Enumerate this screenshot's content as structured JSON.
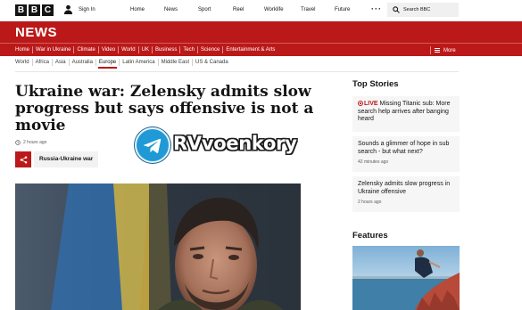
{
  "header": {
    "logo_letters": [
      "B",
      "B",
      "C"
    ],
    "signin_label": "Sign In",
    "nav": [
      "Home",
      "News",
      "Sport",
      "Reel",
      "Worklife",
      "Travel",
      "Future"
    ],
    "more_icon": "ellipsis-icon",
    "search_placeholder": "Search BBC"
  },
  "news_bar": {
    "logo": "NEWS",
    "sections": [
      "Home",
      "War in Ukraine",
      "Climate",
      "Video",
      "World",
      "UK",
      "Business",
      "Tech",
      "Science",
      "Entertainment & Arts"
    ],
    "more_label": "More"
  },
  "sub_nav": {
    "items": [
      "World",
      "Africa",
      "Asia",
      "Australia",
      "Europe",
      "Latin America",
      "Middle East",
      "US & Canada"
    ],
    "active": "Europe"
  },
  "article": {
    "headline": "Ukraine war: Zelensky admits slow progress but says offensive is not a movie",
    "timestamp": "2 hours ago",
    "topic_tag": "Russia-Ukraine war"
  },
  "watermark": {
    "text": "RVvoenkory",
    "icon": "telegram-icon"
  },
  "sidebar": {
    "top_stories_title": "Top Stories",
    "stories": [
      {
        "live": "LIVE",
        "text": "Missing Titanic sub: More search help arrives after banging heard",
        "time": ""
      },
      {
        "live": "",
        "text": "Sounds a glimmer of hope in sub search - but what next?",
        "time": "42 minutes ago"
      },
      {
        "live": "",
        "text": "Zelensky admits slow progress in Ukraine offensive",
        "time": "2 hours ago"
      }
    ],
    "features_title": "Features"
  },
  "colors": {
    "bbc_red": "#bb1919",
    "card_bg": "#f6f6f6",
    "text": "#141414"
  }
}
